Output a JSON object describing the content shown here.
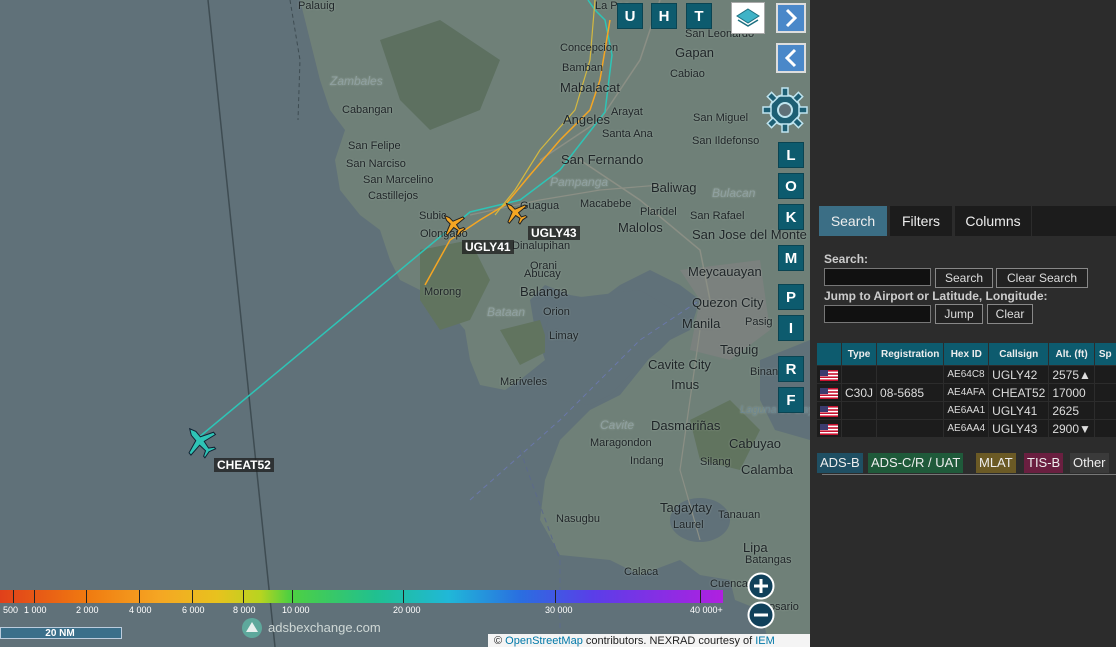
{
  "map": {
    "places": [
      {
        "name": "Palauig",
        "cls": ""
      },
      {
        "name": "Zambales",
        "cls": "region"
      },
      {
        "name": "Cabangan",
        "cls": ""
      },
      {
        "name": "San Felipe",
        "cls": ""
      },
      {
        "name": "San Narciso",
        "cls": ""
      },
      {
        "name": "San Marcelino",
        "cls": ""
      },
      {
        "name": "Castillejos",
        "cls": ""
      },
      {
        "name": "Subic",
        "cls": ""
      },
      {
        "name": "Olongapo",
        "cls": ""
      },
      {
        "name": "Morong",
        "cls": ""
      },
      {
        "name": "Bataan",
        "cls": "region"
      },
      {
        "name": "Balanga",
        "cls": "big"
      },
      {
        "name": "Abucay",
        "cls": ""
      },
      {
        "name": "Orion",
        "cls": ""
      },
      {
        "name": "Limay",
        "cls": ""
      },
      {
        "name": "Mariveles",
        "cls": ""
      },
      {
        "name": "Dinalupihan",
        "cls": ""
      },
      {
        "name": "Orani",
        "cls": ""
      },
      {
        "name": "Concepcion",
        "cls": ""
      },
      {
        "name": "Bamban",
        "cls": ""
      },
      {
        "name": "Mabalacat",
        "cls": "big"
      },
      {
        "name": "Angeles",
        "cls": "big"
      },
      {
        "name": "San Fernando",
        "cls": "big"
      },
      {
        "name": "Pampanga",
        "cls": "region"
      },
      {
        "name": "Guagua",
        "cls": ""
      },
      {
        "name": "Arayat",
        "cls": ""
      },
      {
        "name": "Santa Ana",
        "cls": ""
      },
      {
        "name": "San Miguel",
        "cls": ""
      },
      {
        "name": "San Ildefonso",
        "cls": ""
      },
      {
        "name": "Gapan",
        "cls": "big"
      },
      {
        "name": "Cabiao",
        "cls": ""
      },
      {
        "name": "San Leonardo",
        "cls": ""
      },
      {
        "name": "Baliwag",
        "cls": "big"
      },
      {
        "name": "Bulacan",
        "cls": "region"
      },
      {
        "name": "Macabebe",
        "cls": ""
      },
      {
        "name": "Plaridel",
        "cls": ""
      },
      {
        "name": "Malolos",
        "cls": "big"
      },
      {
        "name": "San Rafael",
        "cls": ""
      },
      {
        "name": "San Jose del Monte",
        "cls": "big"
      },
      {
        "name": "Meycauayan",
        "cls": "big"
      },
      {
        "name": "Quezon City",
        "cls": "big"
      },
      {
        "name": "Manila",
        "cls": "big"
      },
      {
        "name": "Pasig",
        "cls": ""
      },
      {
        "name": "Taguig",
        "cls": "big"
      },
      {
        "name": "Binan",
        "cls": ""
      },
      {
        "name": "Cavite City",
        "cls": "big"
      },
      {
        "name": "Imus",
        "cls": "big"
      },
      {
        "name": "Cavite",
        "cls": "region"
      },
      {
        "name": "Dasmariñas",
        "cls": "big"
      },
      {
        "name": "Cabuyao",
        "cls": "big"
      },
      {
        "name": "Maragondon",
        "cls": ""
      },
      {
        "name": "Indang",
        "cls": ""
      },
      {
        "name": "Silang",
        "cls": ""
      },
      {
        "name": "Calamba",
        "cls": "big"
      },
      {
        "name": "Nasugbu",
        "cls": ""
      },
      {
        "name": "Tagaytay",
        "cls": "big"
      },
      {
        "name": "Laurel",
        "cls": ""
      },
      {
        "name": "Tanauan",
        "cls": ""
      },
      {
        "name": "Lipa",
        "cls": "big"
      },
      {
        "name": "Calaca",
        "cls": ""
      },
      {
        "name": "Cuenca",
        "cls": ""
      },
      {
        "name": "Rosario",
        "cls": ""
      },
      {
        "name": "Batangas",
        "cls": ""
      },
      {
        "name": "Laguna de Bay",
        "cls": "sea"
      },
      {
        "name": "La Paz",
        "cls": ""
      }
    ],
    "aircraft": [
      {
        "callsign": "UGLY41",
        "color": "#f5a623"
      },
      {
        "callsign": "UGLY43",
        "color": "#f5a623"
      },
      {
        "callsign": "CHEAT52",
        "color": "#2ec4b6"
      }
    ],
    "top_buttons": [
      "U",
      "H",
      "T"
    ],
    "side_buttons": [
      "L",
      "O",
      "K",
      "M",
      "P",
      "I",
      "R",
      "F"
    ],
    "icons": {
      "layers": "layers-icon",
      "forward": "chevron-right-icon",
      "back": "chevron-left-icon",
      "settings": "gear-icon",
      "zoom_in": "plus-icon",
      "zoom_out": "minus-icon",
      "logo": "adsbexchange-logo-icon"
    },
    "altitude_scale": {
      "ticks": [
        "500",
        "1 000",
        "2 000",
        "4 000",
        "6 000",
        "8 000",
        "10 000",
        "20 000",
        "30 000",
        "40 000+"
      ]
    },
    "scale_bar": "20 NM",
    "watermark": "adsbexchange.com",
    "attribution": {
      "prefix": "©",
      "link1": "OpenStreetMap",
      "middle": "contributors. NEXRAD courtesy of",
      "link2": "IEM"
    }
  },
  "panel": {
    "tabs": [
      "Search",
      "Filters",
      "Columns"
    ],
    "search_label": "Search:",
    "search_button": "Search",
    "clear_search_button": "Clear Search",
    "jump_label": "Jump to Airport or Latitude, Longitude:",
    "jump_button": "Jump",
    "clear_button": "Clear",
    "table": {
      "headers": [
        "",
        "Type",
        "Registration",
        "Hex ID",
        "Callsign",
        "Alt. (ft)",
        "Sp"
      ],
      "rows": [
        {
          "type": "",
          "registration": "",
          "hex": "AE64C8",
          "callsign": "UGLY42",
          "alt": "2575▲"
        },
        {
          "type": "C30J",
          "registration": "08-5685",
          "hex": "AE4AFA",
          "callsign": "CHEAT52",
          "alt": "17000"
        },
        {
          "type": "",
          "registration": "",
          "hex": "AE6AA1",
          "callsign": "UGLY41",
          "alt": "2625"
        },
        {
          "type": "",
          "registration": "",
          "hex": "AE6AA4",
          "callsign": "UGLY43",
          "alt": "2900▼"
        }
      ]
    },
    "sources": [
      {
        "label": "ADS-B",
        "color": "#1f4f63"
      },
      {
        "label": "ADS-C/R / UAT",
        "color": "#1f5a3a"
      },
      {
        "label": "MLAT",
        "color": "#6b5a25"
      },
      {
        "label": "TIS-B",
        "color": "#6a1f40"
      },
      {
        "label": "Other",
        "color": "#3a3a3a"
      }
    ]
  }
}
